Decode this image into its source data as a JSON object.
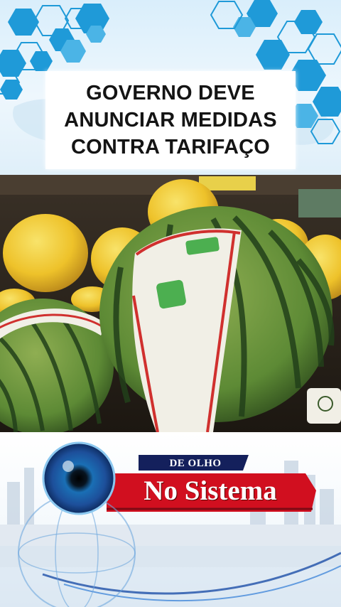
{
  "headline": {
    "text": "GOVERNO DEVE\nANUNCIAR MEDIDAS\nCONTRA TARIFAÇO"
  },
  "logo": {
    "subtitle": "DE OLHO",
    "title": "No Sistema"
  },
  "colors": {
    "hex_blue": "#1f9ad8",
    "logo_red": "#d10f1f",
    "logo_navy": "#14205c",
    "watermelon_green": "#3d6f2c",
    "melon_yellow": "#f2c52a"
  },
  "icons": [
    "hexagon-pattern",
    "eye-globe-icon"
  ]
}
